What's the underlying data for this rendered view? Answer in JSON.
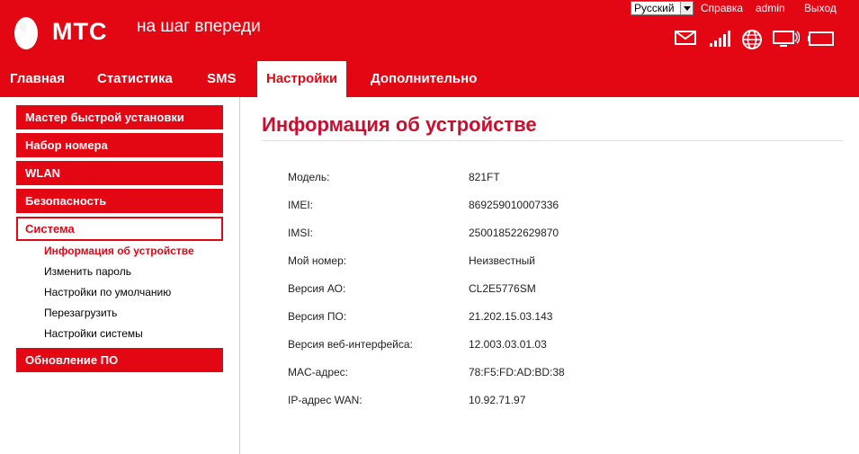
{
  "header": {
    "brand": "МТС",
    "slogan": "на шаг впереди",
    "language": "Русский",
    "help": "Справка",
    "user": "admin",
    "logout": "Выход",
    "accent_color": "#e30613"
  },
  "status_icons": [
    "mail-icon",
    "signal-icon",
    "globe-icon",
    "screen-icon",
    "battery-icon"
  ],
  "nav": {
    "tabs": [
      "Главная",
      "Статистика",
      "SMS",
      "Настройки",
      "Дополнительно"
    ],
    "active": "Настройки"
  },
  "sidebar": {
    "items": [
      "Мастер быстрой установки",
      "Набор номера",
      "WLAN",
      "Безопасность",
      "Система",
      "Обновление ПО"
    ],
    "selected": "Система",
    "subitems": [
      "Информация об устройстве",
      "Изменить пароль",
      "Настройки по умолчанию",
      "Перезагрузить",
      "Настройки системы"
    ],
    "active_subitem": "Информация об устройстве"
  },
  "main": {
    "title": "Информация об устройстве",
    "rows": [
      {
        "label": "Модель:",
        "value": "821FT"
      },
      {
        "label": "IMEI:",
        "value": "869259010007336"
      },
      {
        "label": "IMSI:",
        "value": "250018522629870"
      },
      {
        "label": "Мой номер:",
        "value": "Неизвестный"
      },
      {
        "label": "Версия АО:",
        "value": "CL2E5776SM"
      },
      {
        "label": "Версия ПО:",
        "value": "21.202.15.03.143"
      },
      {
        "label": "Версия веб-интерфейса:",
        "value": "12.003.03.01.03"
      },
      {
        "label": "MAC-адрес:",
        "value": "78:F5:FD:AD:BD:38"
      },
      {
        "label": "IP-адрес WAN:",
        "value": "10.92.71.97"
      }
    ]
  }
}
